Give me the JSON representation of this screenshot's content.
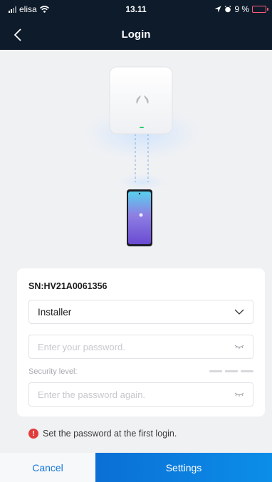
{
  "status_bar": {
    "carrier": "elisa",
    "time": "13.11",
    "battery": "9 %"
  },
  "header": {
    "title": "Login",
    "back_icon": "chevron-left-icon"
  },
  "illustration": {
    "device_brand_icon": "huawei-logo-icon",
    "status_led_color": "#2ecc71"
  },
  "form": {
    "sn": "SN:HV21A0061356",
    "role_value": "Installer",
    "password_placeholder": "Enter your password.",
    "security_label": "Security level:",
    "confirm_placeholder": "Enter the password again."
  },
  "hint": {
    "text": "Set the password at the first login."
  },
  "footer": {
    "cancel_label": "Cancel",
    "settings_label": "Settings"
  },
  "colors": {
    "header_bg": "#0d1b2a",
    "accent": "#1677d9",
    "warning": "#e23b3b"
  }
}
